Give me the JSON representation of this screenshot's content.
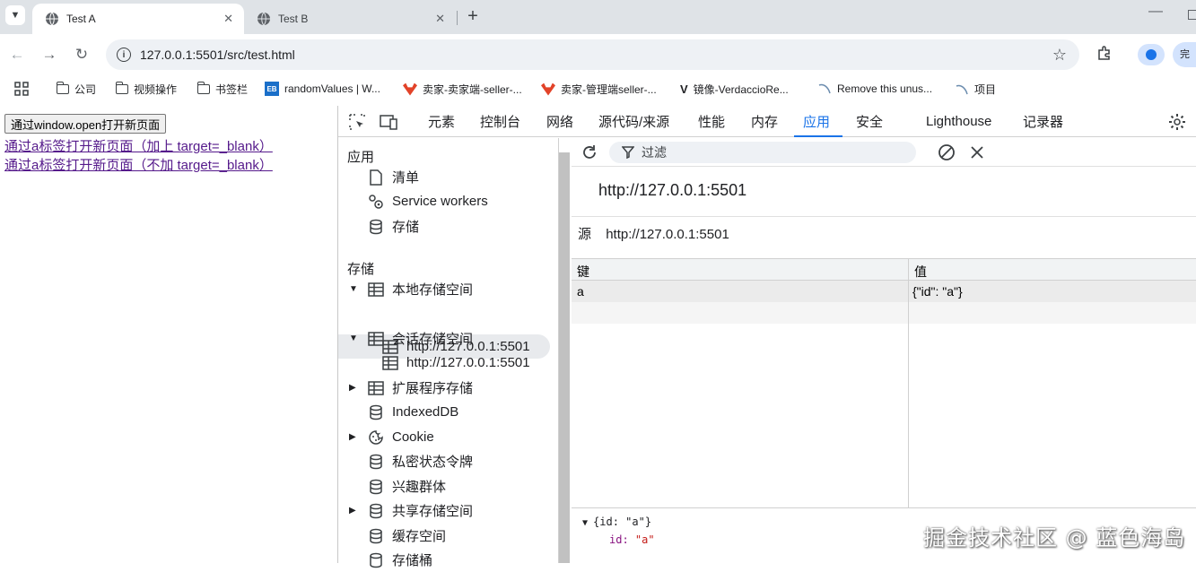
{
  "browser": {
    "tabs": [
      {
        "label": "Test A",
        "active": true
      },
      {
        "label": "Test B",
        "active": false
      }
    ],
    "address_url": "127.0.0.1:5501/src/test.html",
    "profile_label": "完"
  },
  "bookmarks": [
    {
      "label": "公司",
      "icon": "folder-icon"
    },
    {
      "label": "视频操作",
      "icon": "folder-icon"
    },
    {
      "label": "书签栏",
      "icon": "folder-icon"
    },
    {
      "label": "randomValues | W...",
      "icon": "eb-icon"
    },
    {
      "label": "卖家-卖家端-seller-...",
      "icon": "gitlab-fox-icon"
    },
    {
      "label": "卖家-管理端seller-...",
      "icon": "gitlab-fox-icon"
    },
    {
      "label": "镜像-VerdaccioRe...",
      "icon": "verdaccio-icon"
    },
    {
      "label": "Remove this unus...",
      "icon": "swoosh-icon"
    },
    {
      "label": "项目",
      "icon": "swoosh-icon"
    }
  ],
  "page": {
    "button_label": "通过window.open打开新页面",
    "link1": "通过a标签打开新页面（加上 target=_blank）",
    "link2": "通过a标签打开新页面（不加 target=_blank）"
  },
  "devtools": {
    "tabs": [
      "元素",
      "控制台",
      "网络",
      "源代码/来源",
      "性能",
      "内存",
      "应用",
      "安全",
      "Lighthouse",
      "记录器"
    ],
    "active_tab": "应用",
    "sidebar": {
      "section_app": "应用",
      "app_items": [
        "清单",
        "Service workers",
        "存储"
      ],
      "section_storage": "存储",
      "local_storage": "本地存储空间",
      "local_origin": "http://127.0.0.1:5501",
      "session_storage": "会话存储空间",
      "session_origin": "http://127.0.0.1:5501",
      "ext_storage": "扩展程序存储",
      "indexeddb": "IndexedDB",
      "cookie": "Cookie",
      "private_token": "私密状态令牌",
      "interest_groups": "兴趣群体",
      "shared_storage": "共享存储空间",
      "cache_storage": "缓存空间",
      "buckets": "存储桶"
    },
    "main": {
      "filter_placeholder": "过滤",
      "origin_title": "http://127.0.0.1:5501",
      "source_label": "源",
      "source_value": "http://127.0.0.1:5501",
      "columns": [
        "键",
        "值"
      ],
      "rows": [
        {
          "key": "a",
          "value": "{\"id\": \"a\"}"
        }
      ],
      "preview_line1": "{id: \"a\"}",
      "preview_key": "id:",
      "preview_val": "\"a\""
    }
  },
  "watermark": "掘金技术社区 @ 蓝色海岛"
}
